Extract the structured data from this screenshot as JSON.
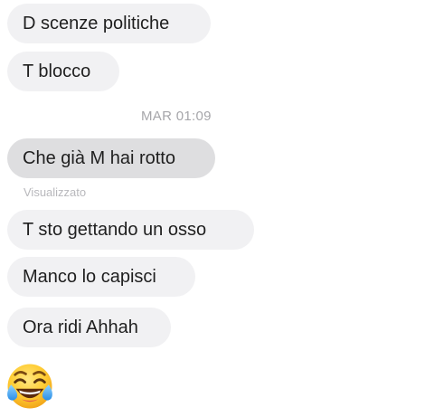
{
  "messages": [
    {
      "text": "D scenze politiche"
    },
    {
      "text": "T blocco"
    },
    {
      "text": "Che già M hai rotto"
    },
    {
      "text": "T sto gettando un osso"
    },
    {
      "text": "Manco lo capisci"
    },
    {
      "text": "Ora ridi Ahhah"
    }
  ],
  "timestamp": "MAR 01:09",
  "seen_status": "Visualizzato",
  "reaction_emoji": "face-with-tears-of-joy",
  "colors": {
    "bubble": "#f1f1f3",
    "bubble_highlighted": "#dedee0",
    "text": "#1f1f1f",
    "meta": "#a6a6aa"
  }
}
